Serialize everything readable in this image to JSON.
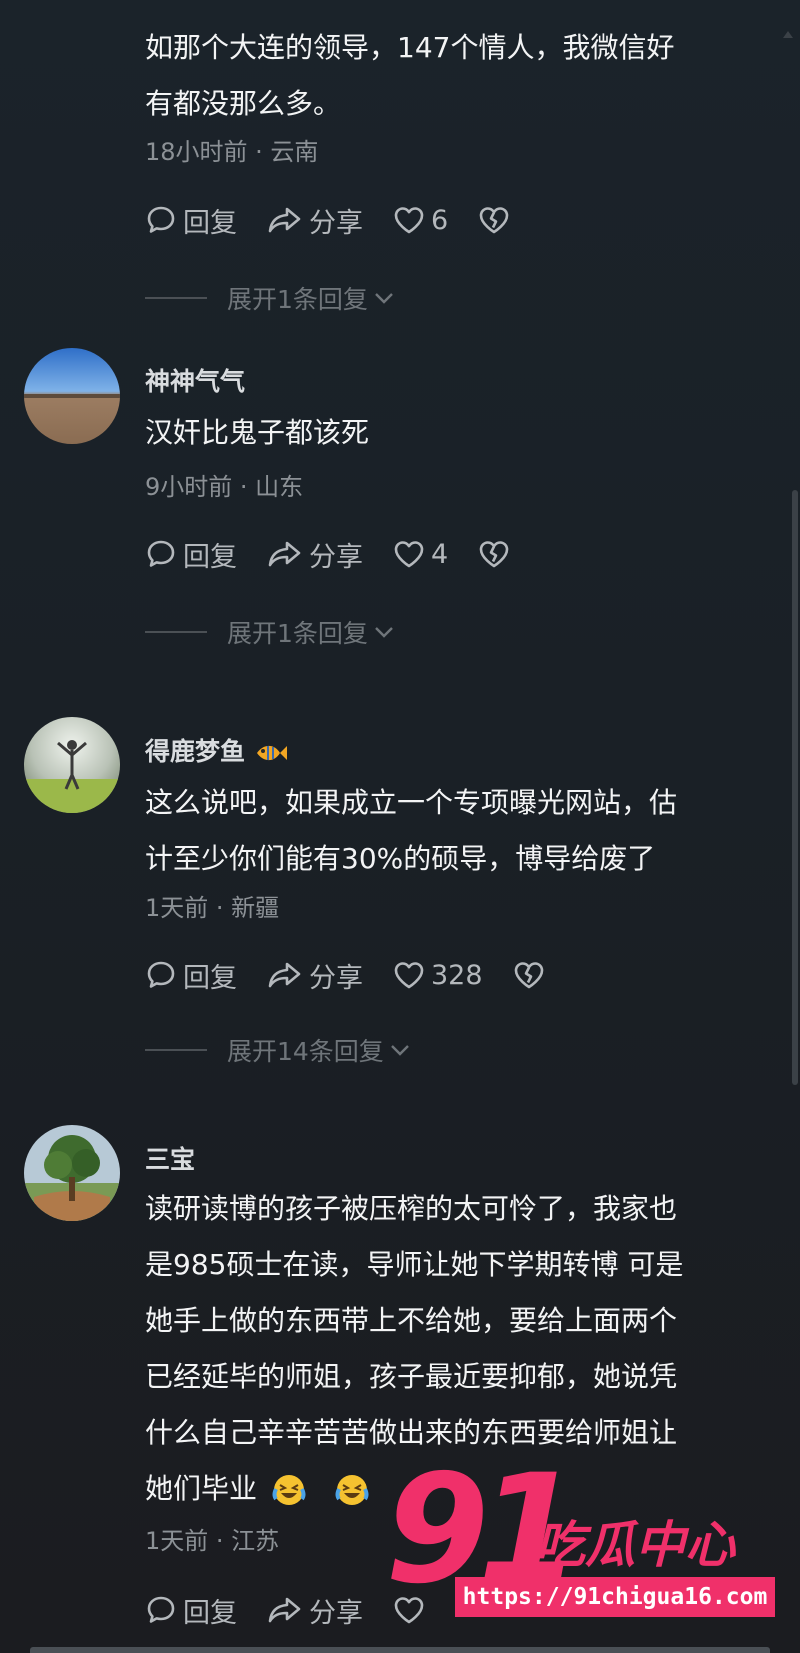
{
  "comments": [
    {
      "name": "",
      "lines": [
        "如那个大连的领导，147个情人，我微信好",
        "有都没那么多。"
      ],
      "meta": "18小时前 · 云南",
      "reply_label": "回复",
      "share_label": "分享",
      "likes": "6",
      "expand_label": "展开1条回复"
    },
    {
      "name": "神神气气",
      "lines": [
        "汉奸比鬼子都该死"
      ],
      "meta": "9小时前 · 山东",
      "reply_label": "回复",
      "share_label": "分享",
      "likes": "4",
      "expand_label": "展开1条回复"
    },
    {
      "name": "得鹿梦鱼",
      "name_emoji": "fish-emoji",
      "lines": [
        "这么说吧，如果成立一个专项曝光网站，估",
        "计至少你们能有30%的硕导，博导给废了"
      ],
      "meta": "1天前 · 新疆",
      "reply_label": "回复",
      "share_label": "分享",
      "likes": "328",
      "expand_label": "展开14条回复"
    },
    {
      "name": "三宝",
      "lines": [
        "读研读博的孩子被压榨的太可怜了，我家也",
        "是985硕士在读，导师让她下学期转博 可是",
        "她手上做的东西带上不给她，要给上面两个",
        "已经延毕的师姐，孩子最近要抑郁，她说凭",
        "什么自己辛辛苦苦做出来的东西要给师姐让",
        "她们毕业"
      ],
      "line_emojis": [
        "crying-laughing-emoji",
        "crying-laughing-emoji"
      ],
      "meta": "1天前 · 江苏",
      "reply_label": "回复",
      "share_label": "分享"
    }
  ],
  "watermark": {
    "big": "91",
    "cn": "吃瓜中心",
    "url": "https://91chigua16.com"
  },
  "colors": {
    "background": "#1a2026",
    "text": "#f3f4f5",
    "meta": "#8c9196",
    "watermark": "#f0306a"
  }
}
